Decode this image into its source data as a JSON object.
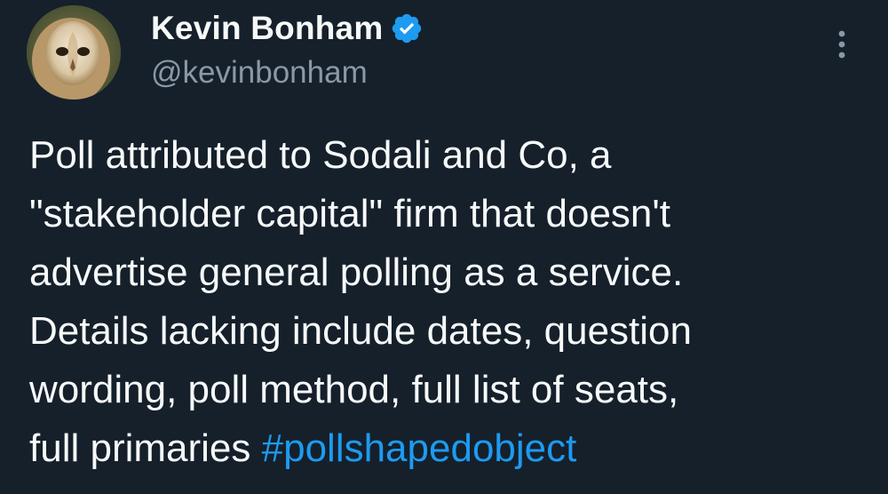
{
  "author": {
    "display_name": "Kevin Bonham",
    "handle": "@kevinbonham",
    "verified": true,
    "avatar_icon": "owl-avatar"
  },
  "menu": {
    "icon": "more-options-icon"
  },
  "tweet": {
    "lines": [
      "Poll attributed to Sodali and Co, a",
      "\"stakeholder capital\" firm that doesn't",
      "advertise general polling as a service.",
      "Details lacking include dates, question",
      "wording, poll method, full list of seats,"
    ],
    "last_line_text": "full primaries ",
    "hashtag": "#pollshapedobject"
  },
  "colors": {
    "background": "#15202b",
    "text": "#f7f9f9",
    "secondary_text": "#8b98a5",
    "link": "#1d9bf0",
    "verified_badge": "#1d9bf0"
  }
}
